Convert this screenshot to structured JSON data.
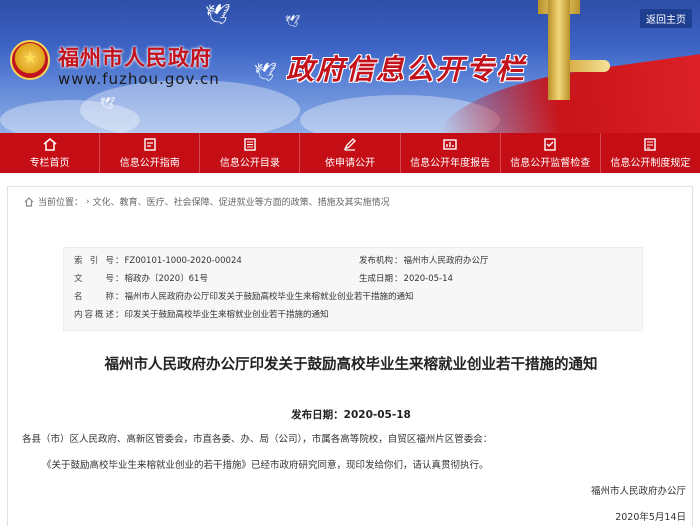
{
  "header": {
    "site_name": "福州市人民政府",
    "site_url": "www.fuzhou.gov.cn",
    "column_title": "政府信息公开专栏",
    "back_home": "返回主页"
  },
  "nav": {
    "items": [
      {
        "label": "专栏首页",
        "icon": "home-icon"
      },
      {
        "label": "信息公开指南",
        "icon": "guide-icon"
      },
      {
        "label": "信息公开目录",
        "icon": "catalog-icon"
      },
      {
        "label": "依申请公开",
        "icon": "apply-icon"
      },
      {
        "label": "信息公开年度报告",
        "icon": "report-icon"
      },
      {
        "label": "信息公开监督检查",
        "icon": "inspection-icon"
      },
      {
        "label": "信息公开制度规定",
        "icon": "regulation-icon"
      }
    ]
  },
  "breadcrumb": {
    "prefix": "当前位置：",
    "path": "文化、教育、医疗、社会保障、促进就业等方面的政策、措施及其实施情况"
  },
  "meta": {
    "index_label": "索引号",
    "index_value": "FZ00101-1000-2020-00024",
    "org_label": "发布机构",
    "org_value": "福州市人民政府办公厅",
    "docno_label": "文 号",
    "docno_value": "榕政办〔2020〕61号",
    "gendate_label": "生成日期",
    "gendate_value": "2020-05-14",
    "name_label": "名 称",
    "name_value": "福州市人民政府办公厅印发关于鼓励高校毕业生来榕就业创业若干措施的通知",
    "summary_label": "内容概述",
    "summary_value": "印发关于鼓励高校毕业生来榕就业创业若干措施的通知"
  },
  "article": {
    "title": "福州市人民政府办公厅印发关于鼓励高校毕业生来榕就业创业若干措施的通知",
    "pub_date": "发布日期：2020-05-18",
    "salutation": "各县（市）区人民政府、高新区管委会，市直各委、办、局（公司），市属各高等院校，自贸区福州片区管委会：",
    "body": "《关于鼓励高校毕业生来榕就业创业的若干措施》已经市政府研究同意，现印发给你们，请认真贯彻执行。",
    "sign_org": "福州市人民政府办公厅",
    "sign_date": "2020年5月14日"
  },
  "colors": {
    "brand_red": "#c40d15",
    "banner_blue": "#3c63c4",
    "gold": "#e0a21a"
  }
}
